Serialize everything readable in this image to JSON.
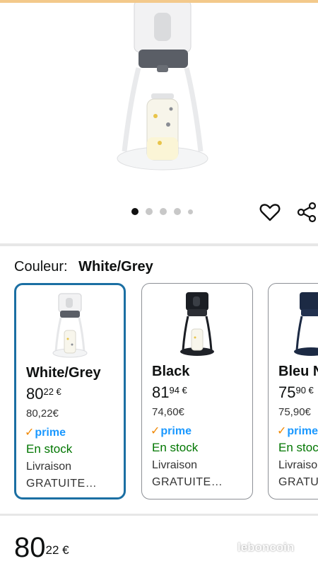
{
  "hero": {
    "image_alt": "",
    "carousel_dots": 5,
    "active_dot": 0
  },
  "actions": {
    "heart_icon": "heart-outline-icon",
    "share_icon": "share-icon"
  },
  "color_selector": {
    "label": "Couleur:",
    "value": "White/Grey"
  },
  "variants": [
    {
      "name": "White/Grey",
      "price_int": "80",
      "price_dec": "22 €",
      "list_price": "80,22€",
      "prime": "prime",
      "stock": "En stock",
      "delivery_line1": "Livraison",
      "delivery_line2": "GRATUITE…",
      "selected": true,
      "body_color": "#ffffff"
    },
    {
      "name": "Black",
      "price_int": "81",
      "price_dec": "94 €",
      "list_price": "74,60€",
      "prime": "prime",
      "stock": "En stock",
      "delivery_line1": "Livraison",
      "delivery_line2": "GRATUITE…",
      "selected": false,
      "body_color": "#1b1e24"
    },
    {
      "name": "Bleu N",
      "price_int": "75",
      "price_dec": "90 €",
      "list_price": "75,90€",
      "prime": "prime",
      "stock": "En stoc",
      "delivery_line1": "Livraiso",
      "delivery_line2": "GRATU",
      "selected": false,
      "body_color": "#1c2a44"
    }
  ],
  "bottom": {
    "price_int": "80",
    "price_dec": "22 €"
  },
  "watermark": "leboncoin",
  "colors": {
    "accent_blue": "#1b6fa3",
    "prime_blue": "#1a98ff",
    "prime_check": "#f08804",
    "stock_green": "#007600"
  }
}
